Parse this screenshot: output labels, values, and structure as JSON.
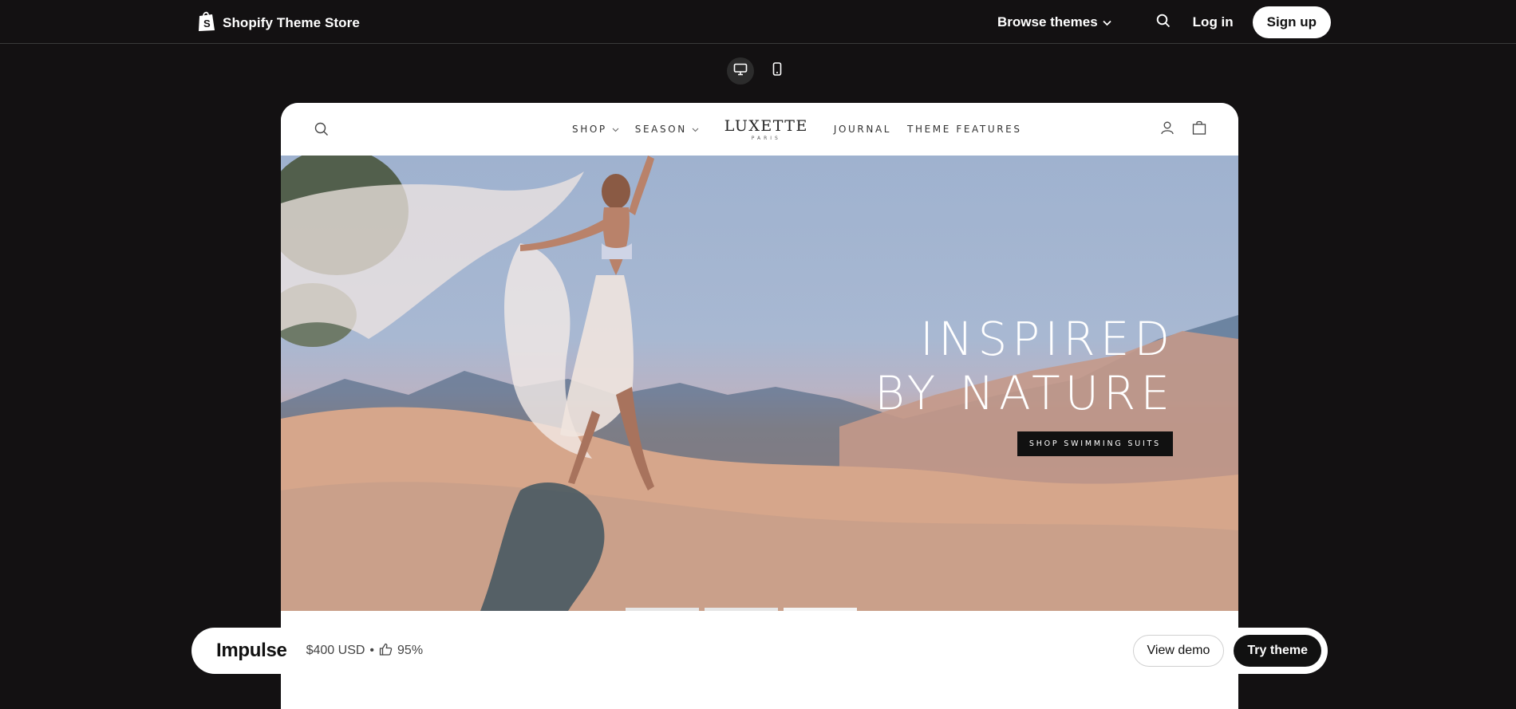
{
  "topbar": {
    "brand_name": "Shopify Theme Store",
    "browse_label": "Browse themes",
    "login_label": "Log in",
    "signup_label": "Sign up"
  },
  "device_toggle": {
    "desktop_icon": "desktop-icon",
    "mobile_icon": "mobile-icon",
    "active": "desktop"
  },
  "store": {
    "nav_left": [
      "SHOP",
      "SEASON"
    ],
    "logo_main": "LUXETTE",
    "logo_sub": "PARIS",
    "nav_right": [
      "JOURNAL",
      "THEME FEATURES"
    ],
    "hero_line_1": "INSPIRED",
    "hero_line_2": "BY NATURE",
    "hero_cta": "SHOP SWIMMING SUITS",
    "slides_total": 3,
    "slide_active": 3
  },
  "theme": {
    "name": "Impulse",
    "price": "$400 USD",
    "separator": "•",
    "rating": "95%",
    "view_demo_label": "View demo",
    "try_theme_label": "Try theme"
  },
  "colors": {
    "page_bg": "#131112",
    "accent_dark": "#111111",
    "white": "#ffffff"
  }
}
